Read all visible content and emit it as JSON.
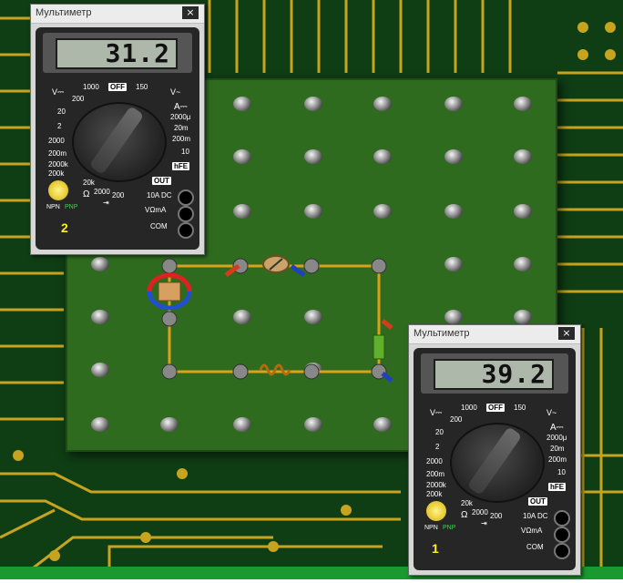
{
  "window_title": "Мультиметр",
  "close_glyph": "×",
  "meter_2": {
    "reading": "31.2",
    "badge": "2",
    "labels": {
      "v_dc": "V⎓",
      "v_ac": "V~",
      "off": "OFF",
      "r1000": "1000",
      "r150": "150",
      "l200a": "200",
      "l20": "20",
      "l2": "2",
      "l2000m": "2000",
      "l200m": "200m",
      "amps": "A⎓",
      "a2000u": "2000μ",
      "a20m": "20m",
      "a200m": "200m",
      "a10": "10",
      "l2000k": "2000k",
      "l200k": "200k",
      "l20k": "20k",
      "l2000": "2000",
      "l200": "200",
      "ohm": "Ω",
      "diode": "⇥",
      "hfe": "hFE",
      "out": "OUT",
      "range_10a": "10A DC",
      "vohm": "VΩmA",
      "com": "COM",
      "npn": "NPN",
      "pnp": "PNP"
    }
  },
  "meter_1": {
    "reading": "39.2",
    "badge": "1",
    "labels": {
      "v_dc": "V⎓",
      "v_ac": "V~",
      "off": "OFF",
      "r1000": "1000",
      "r150": "150",
      "l200a": "200",
      "l20": "20",
      "l2": "2",
      "l2000m": "2000",
      "l200m": "200m",
      "amps": "A⎓",
      "a2000u": "2000μ",
      "a20m": "20m",
      "a200m": "200m",
      "a10": "10",
      "l2000k": "2000k",
      "l200k": "200k",
      "l20k": "20k",
      "l2000": "2000",
      "l200": "200",
      "ohm": "Ω",
      "diode": "⇥",
      "hfe": "hFE",
      "out": "OUT",
      "range_10a": "10A DC",
      "vohm": "VΩmA",
      "com": "COM",
      "npn": "NPN",
      "pnp": "PNP"
    }
  },
  "colors": {
    "pcb": "#0f3d14",
    "board": "#2f6b1f",
    "trace": "#c7a420",
    "wire": "#d9a21a",
    "lcd": "#aeb8aa",
    "badge": "#ffee22"
  },
  "icons": [
    "close-icon",
    "resistor-icon",
    "inductor-icon",
    "electromagnet-icon",
    "coil-icon",
    "probe-icon",
    "stud-icon"
  ]
}
